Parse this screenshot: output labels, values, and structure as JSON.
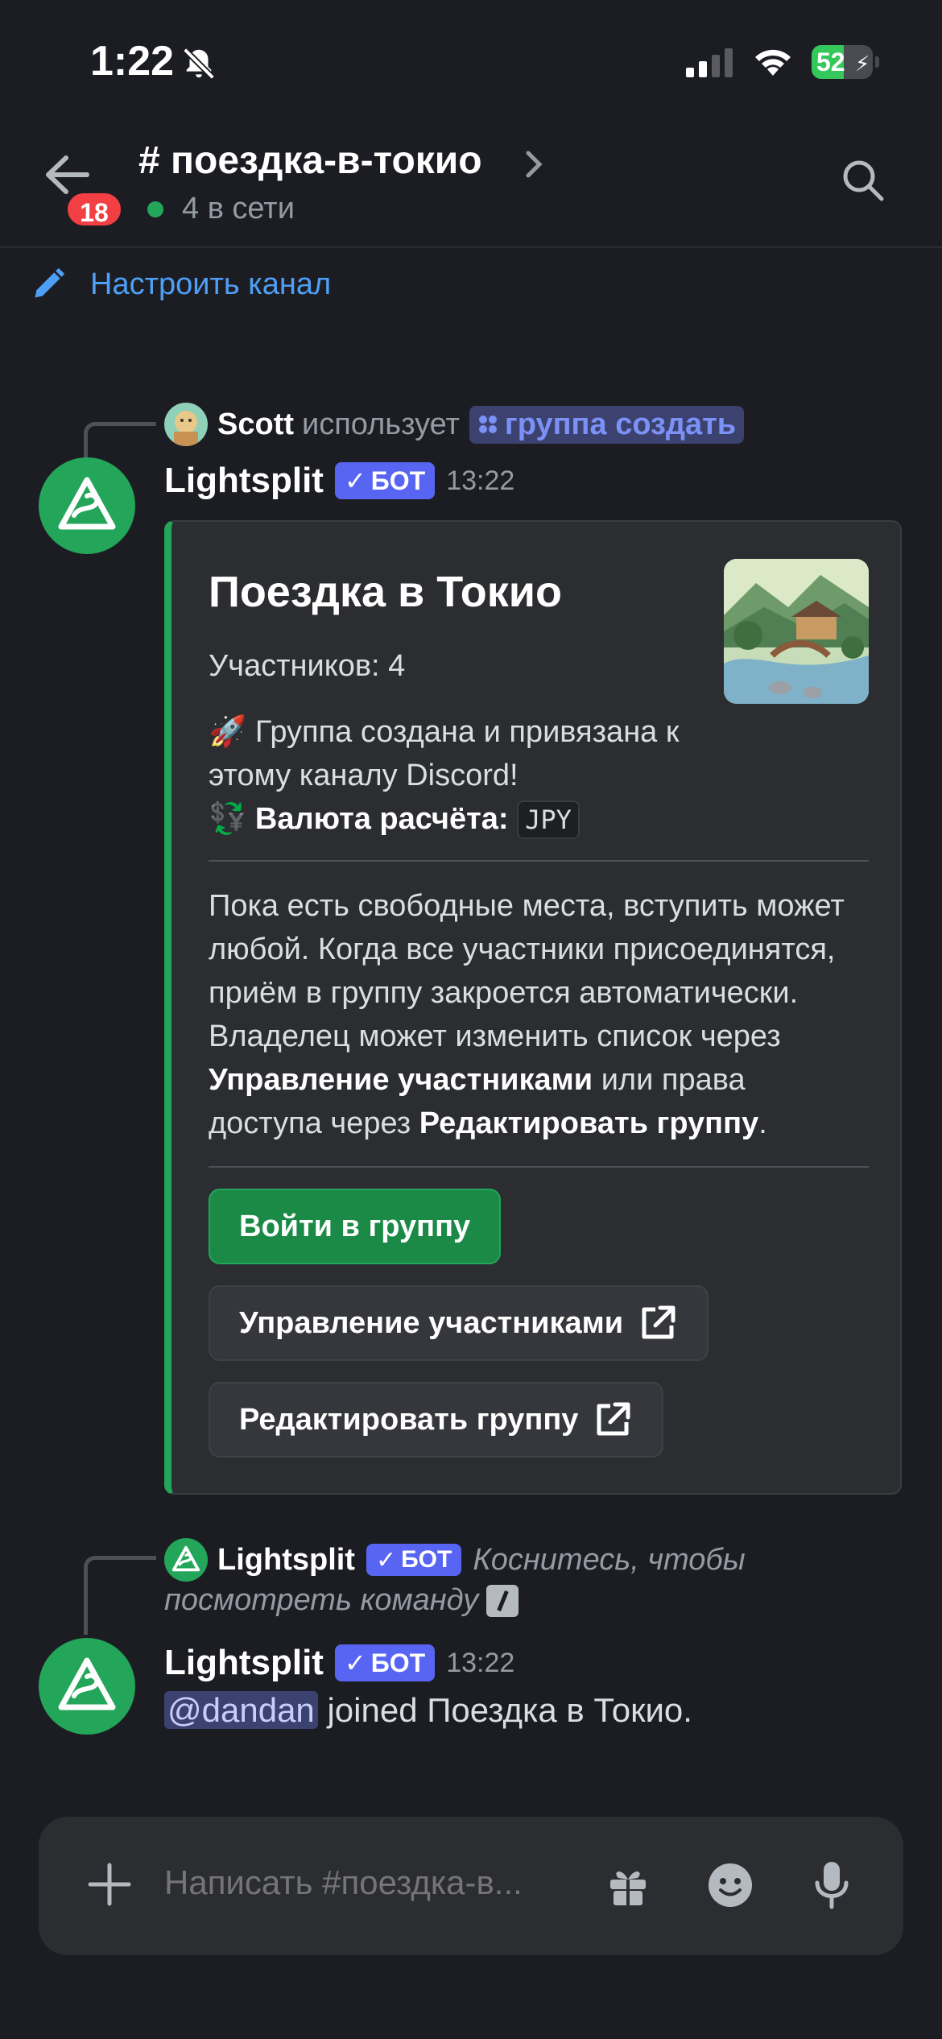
{
  "status_bar": {
    "time": "1:22",
    "battery": "52",
    "battery_level": 0.52
  },
  "header": {
    "channel": "# поездка-в-токио",
    "online": "4 в сети",
    "unread_badge": "18"
  },
  "setup_channel": "Настроить канал",
  "message1": {
    "ref_user": "Scott",
    "ref_verb": "использует",
    "ref_command": "группа создать",
    "author": "Lightsplit",
    "bot_tag": "БОТ",
    "time": "13:22",
    "embed": {
      "title": "Поездка в Токио",
      "participants": "Участников: 4",
      "created_line1": "🚀 Группа создана и привязана к",
      "created_line2": "этому каналу Discord!",
      "currency_label": "Валюта расчёта:",
      "currency_value": "JPY",
      "info_line1": "Пока есть свободные места, вступить может",
      "info_line2": "любой. Когда все участники присоединятся,",
      "info_line3": "приём в группу закроется автоматически.",
      "info_line4": "Владелец может изменить список через",
      "info_line5_bold": "Управление участниками",
      "info_line5_rest": " или права",
      "info_line6_start": "доступа через ",
      "info_line6_bold": "Редактировать группу",
      "info_line6_end": ".",
      "btn_join": "Войти в группу",
      "btn_manage": "Управление участниками",
      "btn_edit": "Редактировать группу"
    }
  },
  "message2": {
    "ref_user": "Lightsplit",
    "ref_bot_tag": "БОТ",
    "ref_text_line1": "Коснитесь, чтобы",
    "ref_text_line2": "посмотреть команду",
    "author": "Lightsplit",
    "bot_tag": "БОТ",
    "time": "13:22",
    "mention": "@dandan",
    "text": " joined Поездка в Токио."
  },
  "composer": {
    "placeholder": "Написать #поездка-в..."
  },
  "colors": {
    "accent": "#5865f2",
    "embed_bar": "#23a55a",
    "link": "#4e9ff5",
    "badge": "#f23f43"
  }
}
